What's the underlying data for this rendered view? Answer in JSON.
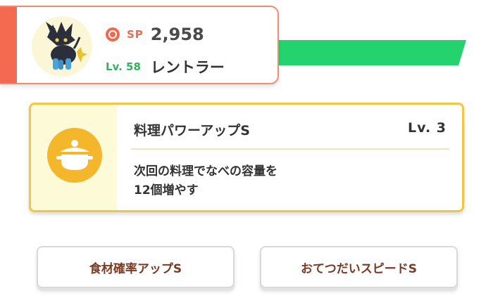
{
  "pokemon": {
    "sp_label": "SP",
    "sp_value": "2,958",
    "level": "Lv. 58",
    "name": "レントラー",
    "avatar_icon": "luxray-sprite",
    "sp_icon": "pokeball-icon"
  },
  "skill": {
    "title": "料理パワーアップS",
    "level": "Lv. 3",
    "description_lines": [
      "次回の料理でなべの容量を",
      "12個増やす"
    ],
    "icon": "pot-icon"
  },
  "buttons": [
    {
      "label": "食材確率アップS"
    },
    {
      "label": "おてつだいスピードS"
    }
  ],
  "colors": {
    "accent_red": "#f26a4f",
    "bar_green": "#25d36e",
    "skill_border": "#f2c643",
    "skill_icon_bg": "#f4b62a",
    "button_text": "#7b3a22",
    "level_green": "#2fb45a"
  }
}
